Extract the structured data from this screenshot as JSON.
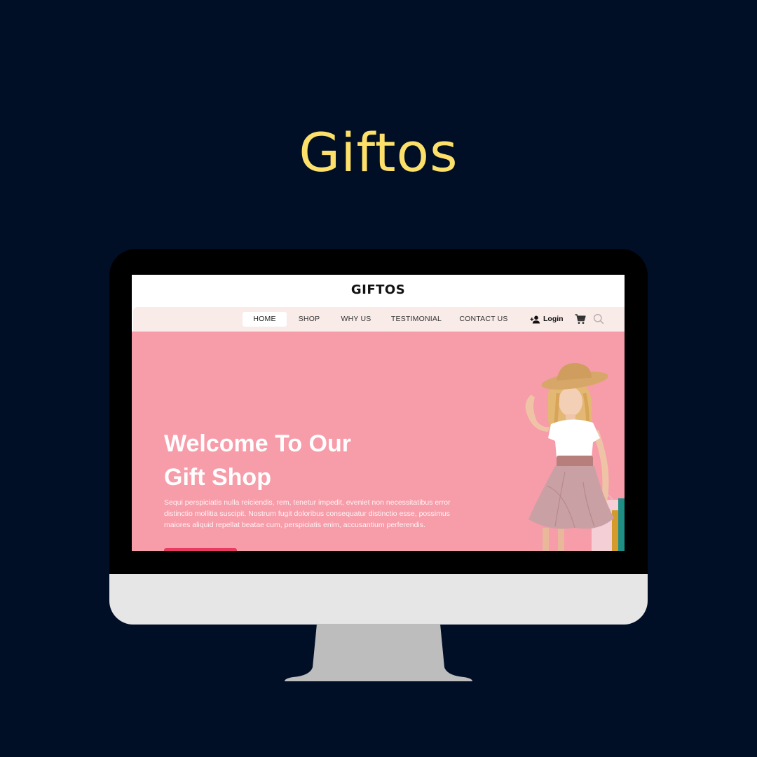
{
  "promo": {
    "title": "Giftos"
  },
  "site": {
    "brand": "GIFTOS",
    "nav": {
      "home": "HOME",
      "shop": "SHOP",
      "why_us": "WHY US",
      "testimonial": "TESTIMONIAL",
      "contact_us": "CONTACT US",
      "active": "HOME"
    },
    "login_label": "Login",
    "icons": [
      "add-user-icon",
      "cart-icon",
      "search-icon"
    ]
  },
  "hero": {
    "title_line1": "Welcome To Our",
    "title_line2": "Gift Shop",
    "text": "Sequi perspiciatis nulla reiciendis, rem, tenetur impedit, eveniet non necessitatibus error distinctio mollitia suscipit. Nostrum fugit doloribus consequatur distinctio esse, possimus maiores aliquid repellat beatae cum, perspiciatis enim, accusantium perferendis."
  },
  "colors": {
    "page_background": "#000f26",
    "title": "#fde06a",
    "hero_background": "#f79ca9",
    "nav_background": "#f8ebe8",
    "button": "#e93b63"
  }
}
